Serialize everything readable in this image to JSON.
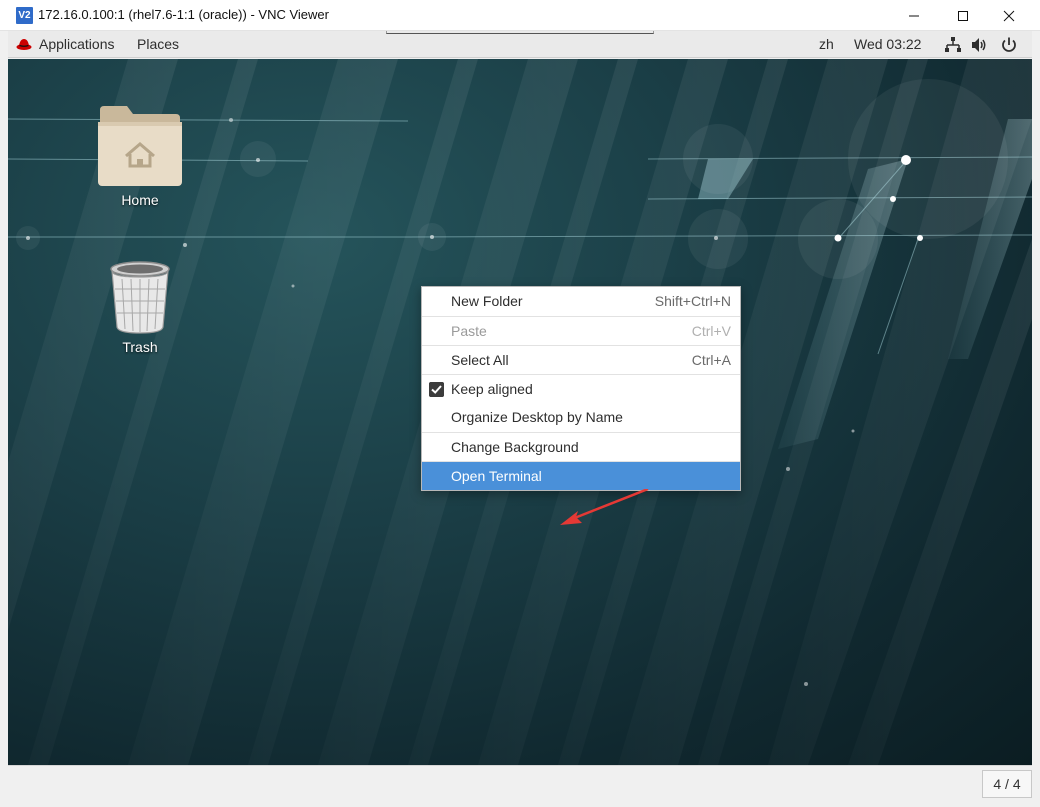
{
  "window": {
    "app_icon_text": "V2",
    "title": "172.16.0.100:1 (rhel7.6-1:1 (oracle)) - VNC Viewer"
  },
  "panel": {
    "applications": "Applications",
    "places": "Places",
    "language": "zh",
    "clock": "Wed 03:22"
  },
  "desktop": {
    "icons": [
      {
        "label": "Home"
      },
      {
        "label": "Trash"
      }
    ]
  },
  "context_menu": {
    "items": [
      {
        "label": "New Folder",
        "shortcut": "Shift+Ctrl+N"
      },
      {
        "label": "Paste",
        "shortcut": "Ctrl+V"
      },
      {
        "label": "Select All",
        "shortcut": "Ctrl+A"
      },
      {
        "label": "Keep aligned"
      },
      {
        "label": "Organize Desktop by Name"
      },
      {
        "label": "Change Background"
      },
      {
        "label": "Open Terminal"
      }
    ]
  },
  "status": {
    "page_counter": "4 / 4"
  },
  "colors": {
    "menu_highlight": "#4a90d9",
    "annotation_arrow": "#e53935",
    "desktop_bg": "#1a3d45"
  }
}
